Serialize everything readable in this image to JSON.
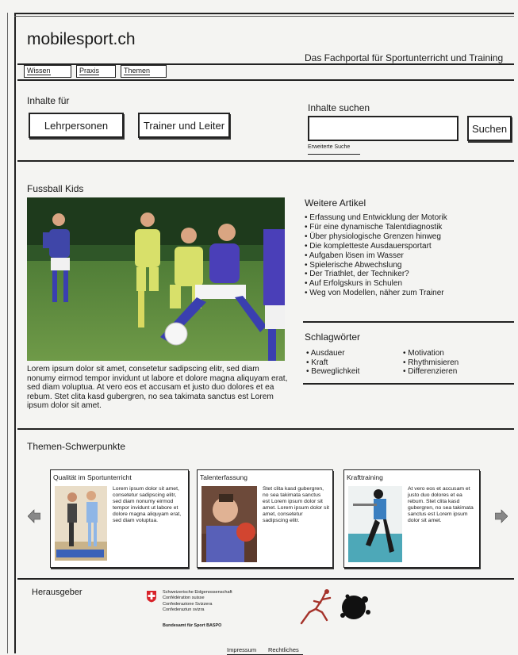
{
  "header": {
    "site_title": "mobilesport.ch",
    "tagline": "Das Fachportal für Sportunterricht und Training"
  },
  "nav": [
    {
      "label": "Wissen"
    },
    {
      "label": "Praxis"
    },
    {
      "label": "Themen"
    }
  ],
  "audience": {
    "title": "Inhalte für",
    "teachers": "Lehrpersonen",
    "trainers": "Trainer und Leiter"
  },
  "search": {
    "title": "Inhalte suchen",
    "button": "Suchen",
    "advanced": "Erweiterte Suche",
    "value": ""
  },
  "feature": {
    "title": "Fussball Kids",
    "text": "Lorem ipsum dolor sit amet, consetetur sadipscing elitr, sed diam nonumy eirmod tempor invidunt ut labore et dolore magna aliquyam erat, sed diam voluptua. At vero eos et accusam et justo duo dolores et ea rebum. Stet clita kasd gubergren, no sea takimata sanctus est Lorem ipsum dolor sit amet."
  },
  "articles": {
    "title": "Weitere Artikel",
    "items": [
      "• Erfassung und Entwicklung der Motorik",
      "• Für eine dynamische Talentdiagnostik",
      "• Über physiologische Grenzen hinweg",
      "• Die kompletteste Ausdauersportart",
      "• Aufgaben lösen im Wasser",
      "• Spielerische Abwechslung",
      "• Der Triathlet, der Techniker?",
      "• Auf Erfolgskurs in Schulen",
      "• Weg von Modellen, näher zum Trainer"
    ]
  },
  "keywords": {
    "title": "Schlagwörter",
    "col1": [
      "• Ausdauer",
      "• Kraft",
      "• Beweglichkeit"
    ],
    "col2": [
      "• Motivation",
      "• Rhythmisieren",
      "• Differenzieren"
    ]
  },
  "focus": {
    "title": "Themen-Schwerpunkte",
    "cards": [
      {
        "title": "Qualität im Sportunterricht",
        "text": "Lorem ipsum dolor sit amet, consetetur sadipscing elitr, sed diam nonumy eirmod tempor invidunt ut labore et dolore magna aliquyam erat, sed diam voluptua."
      },
      {
        "title": "Talenterfassung",
        "text": "Stet clita kasd gubergren, no sea takimata sanctus est Lorem ipsum dolor sit amet. Lorem ipsum dolor sit amet, consetetur sadipscing elitr."
      },
      {
        "title": "Krafttraining",
        "text": "At vero eos et accusam et justo duo dolores et ea rebum. Stet clita kasd gubergren, no sea takimata sanctus est Lorem ipsum dolor sit amet."
      }
    ]
  },
  "publisher": {
    "title": "Herausgeber",
    "confederation": [
      "Schweizerische Eidgenossenschaft",
      "Confédération suisse",
      "Confederazione Svizzera",
      "Confederaziun svizra"
    ],
    "office": "Bundesamt für Sport BASPO"
  },
  "footer": {
    "impressum": "Impressum",
    "legal": "Rechtliches"
  },
  "colors": {
    "swiss_red": "#d8232a",
    "ink": "#1a1a1a"
  }
}
